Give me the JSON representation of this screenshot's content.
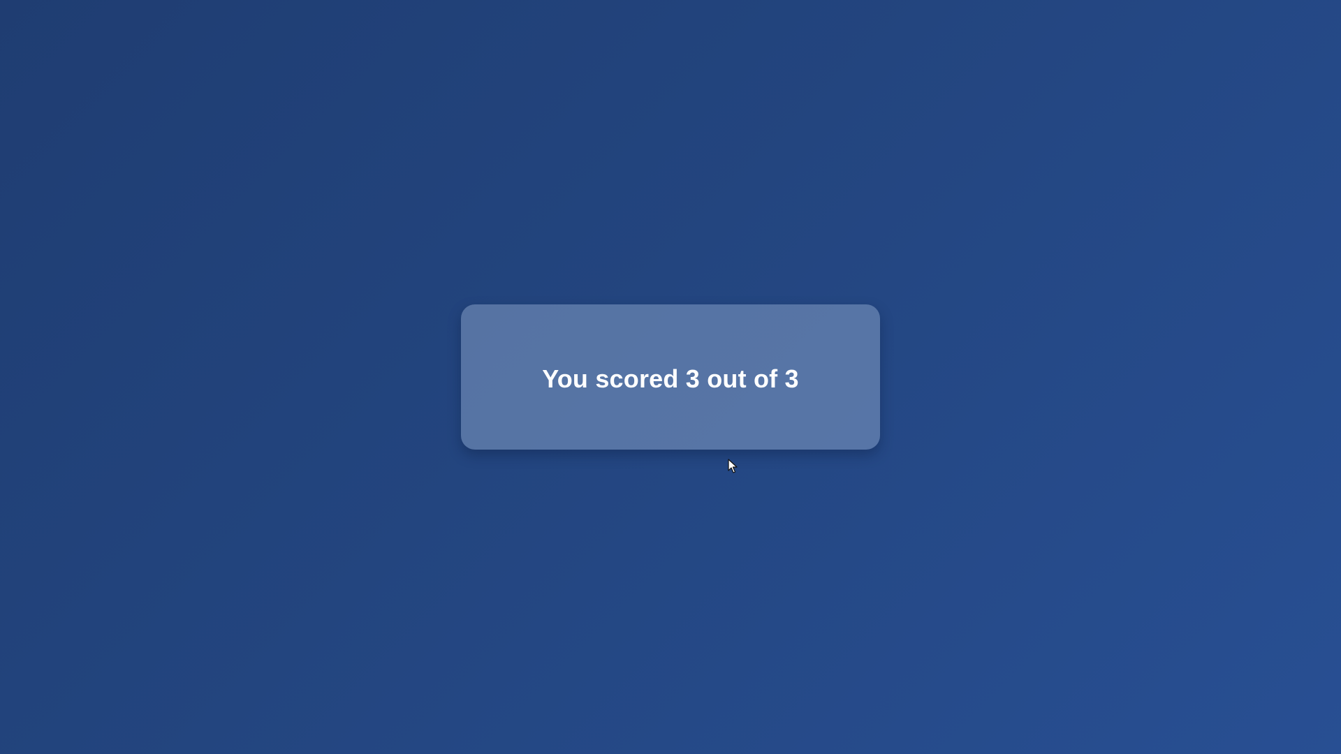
{
  "result": {
    "score_text": "You scored 3 out of 3"
  },
  "colors": {
    "background_start": "#1f3d72",
    "background_end": "#284f93",
    "card": "#5470a3",
    "text": "#ffffff"
  },
  "icons": {
    "cursor": "mouse-pointer-icon"
  }
}
